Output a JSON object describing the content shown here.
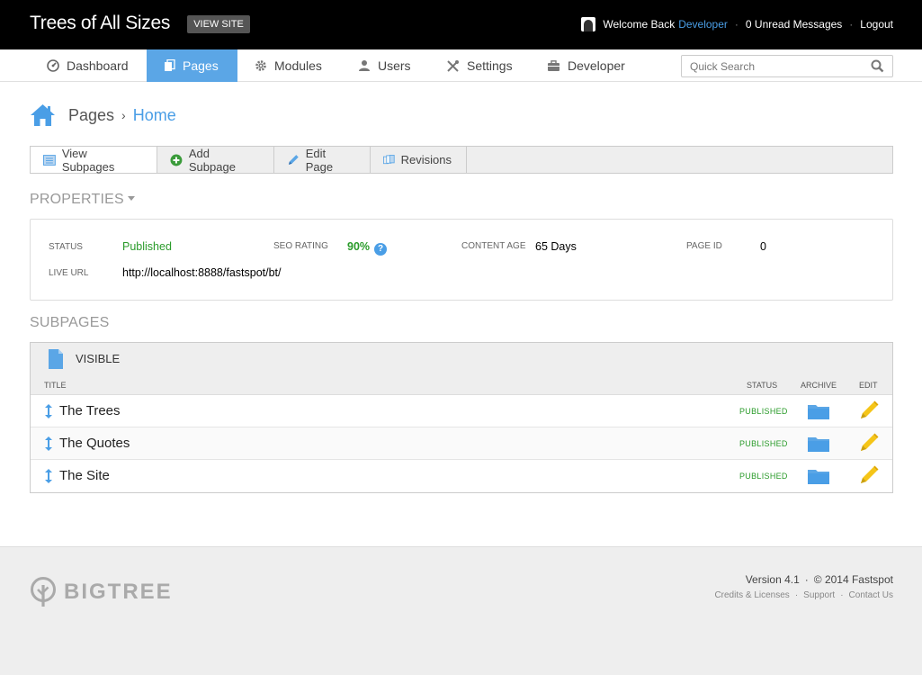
{
  "header": {
    "site_title": "Trees of All Sizes",
    "view_site": "VIEW SITE",
    "welcome": "Welcome Back",
    "user_name": "Developer",
    "unread": "0 Unread Messages",
    "logout": "Logout"
  },
  "nav": {
    "items": [
      {
        "label": "Dashboard",
        "icon": "dashboard-icon"
      },
      {
        "label": "Pages",
        "icon": "pages-icon",
        "active": true
      },
      {
        "label": "Modules",
        "icon": "gear-icon"
      },
      {
        "label": "Users",
        "icon": "user-icon"
      },
      {
        "label": "Settings",
        "icon": "tools-icon"
      },
      {
        "label": "Developer",
        "icon": "briefcase-icon"
      }
    ],
    "search_placeholder": "Quick Search"
  },
  "breadcrumb": {
    "pages": "Pages",
    "separator": "›",
    "current": "Home"
  },
  "tabs": [
    {
      "label": "View Subpages",
      "icon": "list-icon",
      "active": true
    },
    {
      "label": "Add Subpage",
      "icon": "add-icon"
    },
    {
      "label": "Edit Page",
      "icon": "pencil-icon"
    },
    {
      "label": "Revisions",
      "icon": "revisions-icon"
    }
  ],
  "properties": {
    "title": "PROPERTIES",
    "status_label": "STATUS",
    "status_value": "Published",
    "seo_label": "SEO RATING",
    "seo_value": "90%",
    "content_age_label": "CONTENT AGE",
    "content_age_value": "65 Days",
    "page_id_label": "PAGE ID",
    "page_id_value": "0",
    "live_url_label": "LIVE URL",
    "live_url_value": "http://localhost:8888/fastspot/bt/"
  },
  "subpages": {
    "title": "SUBPAGES",
    "group": "VISIBLE",
    "columns": {
      "title": "TITLE",
      "status": "STATUS",
      "archive": "ARCHIVE",
      "edit": "EDIT"
    },
    "rows": [
      {
        "title": "The Trees",
        "status": "PUBLISHED"
      },
      {
        "title": "The Quotes",
        "status": "PUBLISHED"
      },
      {
        "title": "The Site",
        "status": "PUBLISHED"
      }
    ]
  },
  "footer": {
    "logo": "BIGTREE",
    "version": "Version 4.1",
    "copyright": "© 2014 Fastspot",
    "links": [
      "Credits & Licenses",
      "Support",
      "Contact Us"
    ]
  },
  "colors": {
    "accent": "#5ba6e6",
    "published": "#2a9b2a",
    "edit": "#f5c518"
  }
}
